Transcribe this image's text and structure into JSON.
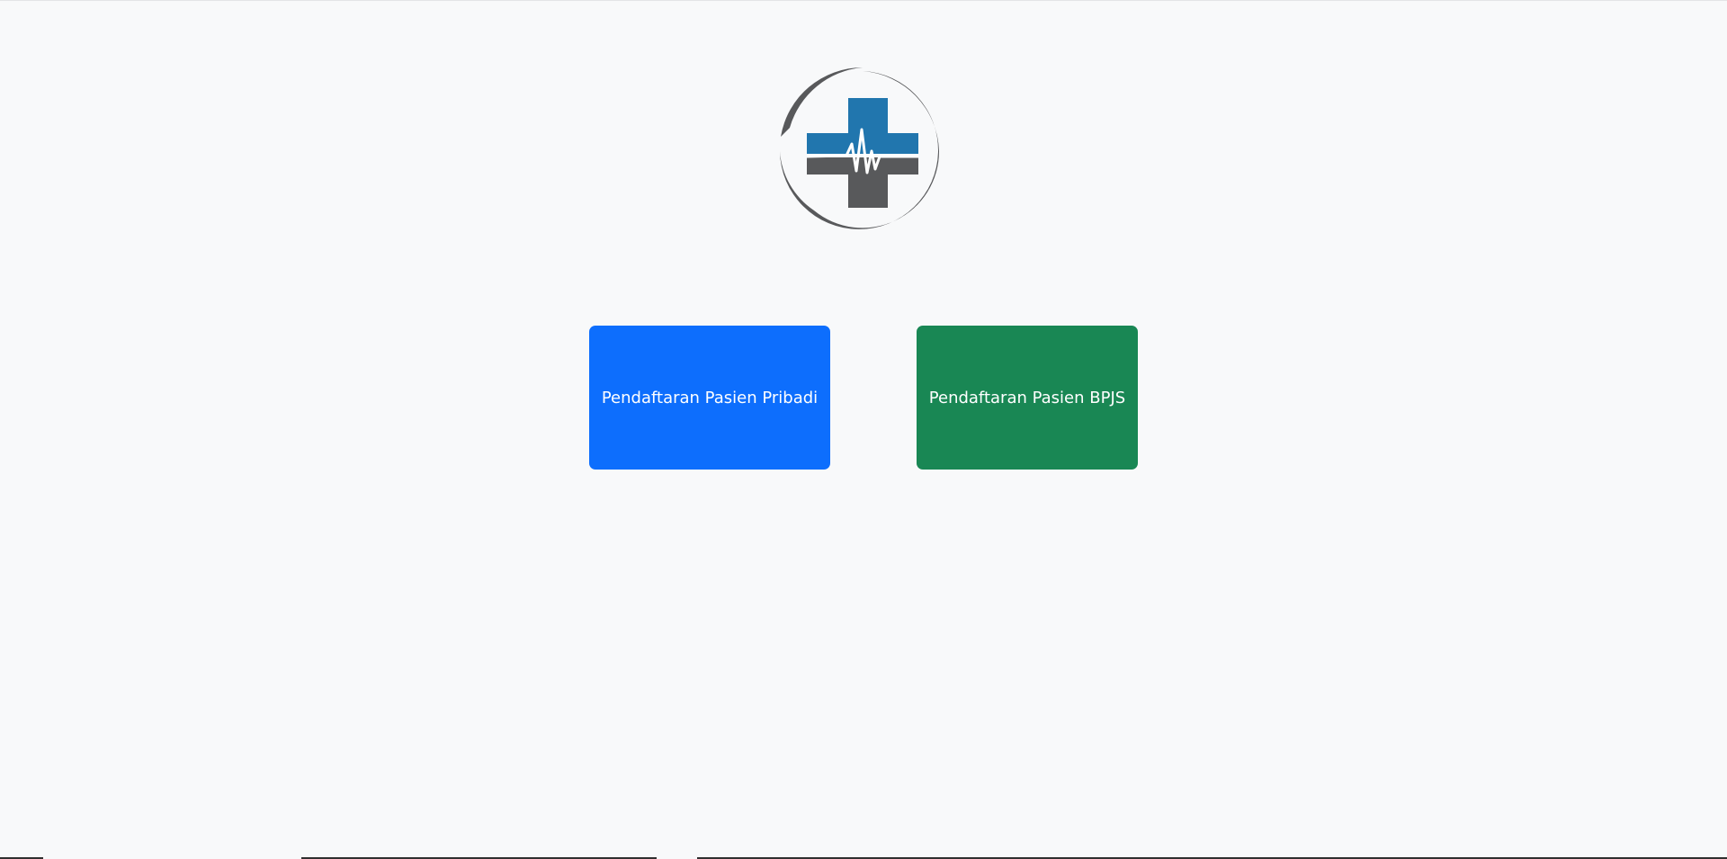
{
  "logo": {
    "icon": "medical-cross-heartbeat-logo",
    "colors": {
      "ring": "#58595b",
      "cross_top": "#2176ae",
      "cross_bottom": "#58595b",
      "heartbeat": "#ffffff"
    }
  },
  "buttons": {
    "pribadi": {
      "label": "Pendaftaran Pasien Pribadi",
      "color": "#0d6efd"
    },
    "bpjs": {
      "label": "Pendaftaran Pasien BPJS",
      "color": "#198754"
    }
  },
  "theme": {
    "background": "#f8f9fa"
  }
}
